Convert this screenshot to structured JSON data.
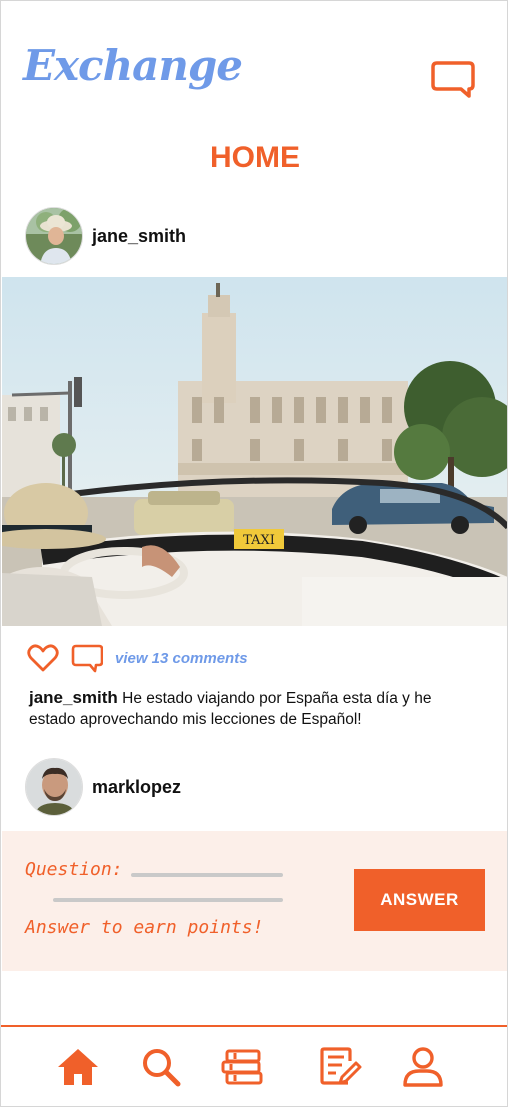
{
  "app": {
    "logo_text": "Exchange"
  },
  "header": {
    "title": "HOME",
    "chat_icon": "chat-bubble-icon"
  },
  "posts": [
    {
      "username": "jane_smith",
      "likes_icon": "heart-icon",
      "comment_icon": "comment-icon",
      "view_comments": "view 13 comments",
      "caption_user": "jane_smith",
      "caption_text": " He estado viajando por España esta día y he estado aprovechando mis lecciones de Español!"
    },
    {
      "username": "marklopez"
    }
  ],
  "question": {
    "label": "Question:",
    "hint": "Answer to earn points!",
    "button_label": "ANSWER"
  },
  "nav": {
    "items": [
      "home-icon",
      "search-icon",
      "books-icon",
      "notes-icon",
      "profile-icon"
    ]
  },
  "colors": {
    "accent": "#f0602a",
    "secondary": "#6f9ae8",
    "card_bg": "#fcefe9"
  }
}
